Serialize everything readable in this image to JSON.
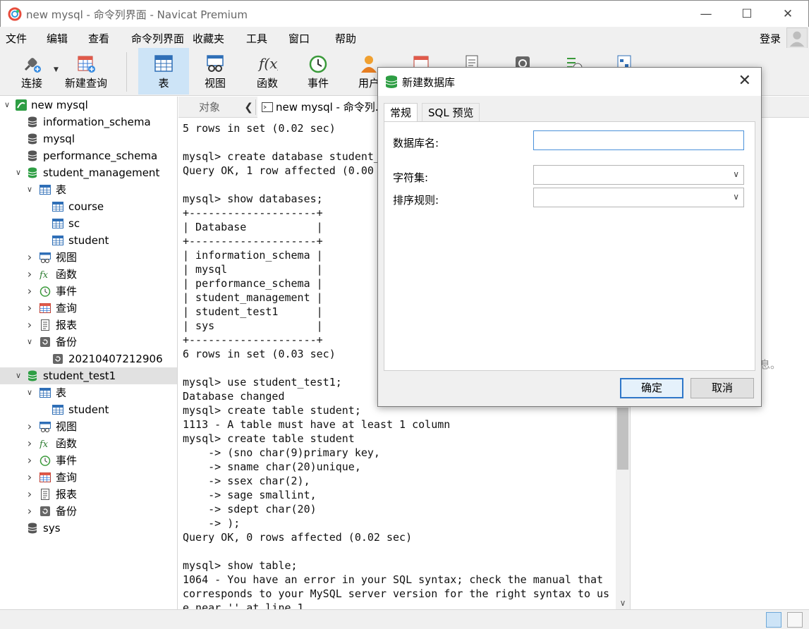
{
  "window": {
    "title": "new mysql - 命令列界面 - Navicat Premium"
  },
  "menu": [
    "文件",
    "编辑",
    "查看",
    "命令列界面",
    "收藏夹",
    "工具",
    "窗口",
    "帮助"
  ],
  "account": {
    "login": "登录"
  },
  "toolbar": {
    "connect": "连接",
    "new_query": "新建查询",
    "table": "表",
    "view": "视图",
    "function": "函数",
    "event": "事件",
    "user": "用户"
  },
  "tree": {
    "connection": "new mysql",
    "items": [
      "information_schema",
      "mysql",
      "performance_schema",
      "student_management",
      "表",
      "course",
      "sc",
      "student",
      "视图",
      "函数",
      "事件",
      "查询",
      "报表",
      "备份",
      "20210407212906",
      "student_test1",
      "表",
      "student",
      "视图",
      "函数",
      "事件",
      "查询",
      "报表",
      "备份",
      "sys"
    ]
  },
  "tabs": {
    "objects": "对象",
    "console": "new mysql - 命令列..."
  },
  "console": {
    "text": "5 rows in set (0.02 sec)\n\nmysql> create database student_\nQuery OK, 1 row affected (0.00\n\nmysql> show databases;\n+--------------------+\n| Database           |\n+--------------------+\n| information_schema |\n| mysql              |\n| performance_schema |\n| student_management |\n| student_test1      |\n| sys                |\n+--------------------+\n6 rows in set (0.03 sec)\n\nmysql> use student_test1;\nDatabase changed\nmysql> create table student;\n1113 - A table must have at least 1 column\nmysql> create table student\n    -> (sno char(9)primary key,\n    -> sname char(20)unique,\n    -> ssex char(2),\n    -> sage smallint,\n    -> sdept char(20)\n    -> );\nQuery OK, 0 rows affected (0.02 sec)\n\nmysql> show table;\n1064 - You have an error in your SQL syntax; check the manual that\ncorresponds to your MySQL server version for the right syntax to us\ne near '' at line 1"
  },
  "right_pane_fragment": "息。",
  "dialog": {
    "title": "新建数据库",
    "tab_general": "常规",
    "tab_sql": "SQL 预览",
    "db_name_label": "数据库名:",
    "db_name_value": "",
    "charset_label": "字符集:",
    "charset_value": "",
    "collation_label": "排序规则:",
    "collation_value": "",
    "ok": "确定",
    "cancel": "取消"
  }
}
